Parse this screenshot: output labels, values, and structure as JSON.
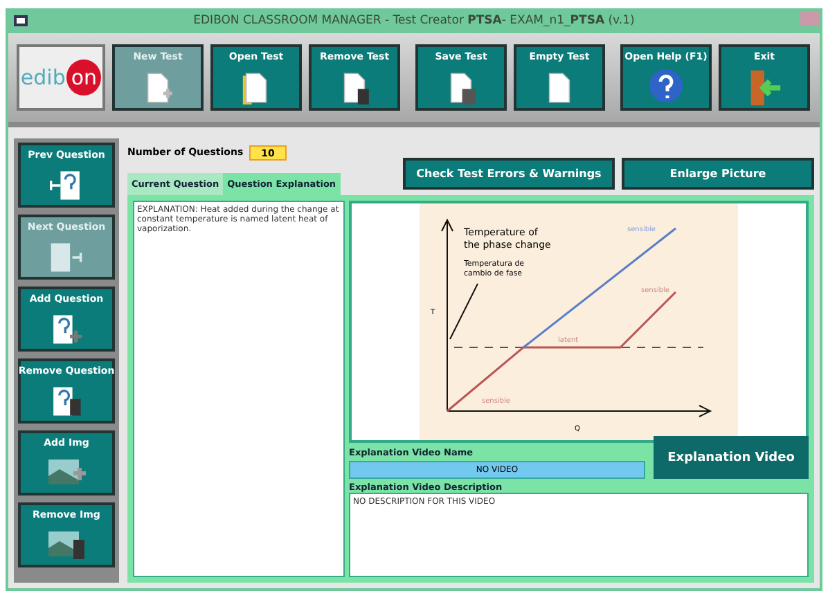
{
  "window": {
    "title": "EDIBON CLASSROOM MANAGER - Test Creator **PTSA**- EXAM_n1_**PTSA** (v.1)"
  },
  "logo": {
    "left": "edib",
    "right": "on"
  },
  "toolbar": [
    {
      "label": "New Test",
      "kind": "new",
      "disabled": true
    },
    {
      "label": "Open Test",
      "kind": "open",
      "disabled": false
    },
    {
      "label": "Remove Test",
      "kind": "remove",
      "disabled": false
    },
    {
      "label": "Save Test",
      "kind": "save",
      "disabled": false
    },
    {
      "label": "Empty Test",
      "kind": "empty",
      "disabled": false
    },
    {
      "label": "Open Help (F1)",
      "kind": "help",
      "disabled": false
    },
    {
      "label": "Exit",
      "kind": "exit",
      "disabled": false
    }
  ],
  "sidebar": [
    {
      "label": "Prev Question",
      "kind": "prev",
      "disabled": false
    },
    {
      "label": "Next Question",
      "kind": "next",
      "disabled": true
    },
    {
      "label": "Add Question",
      "kind": "add",
      "disabled": false
    },
    {
      "label": "Remove Question",
      "kind": "removeq",
      "disabled": false
    },
    {
      "label": "Add Img",
      "kind": "addimg",
      "disabled": false
    },
    {
      "label": "Remove Img",
      "kind": "removeimg",
      "disabled": false
    }
  ],
  "number_of_questions": {
    "label": "Number of Questions",
    "value": "10"
  },
  "tabs": [
    {
      "label": "Current Question",
      "selected": false
    },
    {
      "label": "Question Explanation",
      "selected": true
    }
  ],
  "actions": [
    "Check Test Errors & Warnings",
    "Enlarge Picture"
  ],
  "explanation": {
    "value": "EXPLANATION: Heat added during the change at constant temperature is named latent heat of vaporization."
  },
  "figure": {
    "title_en": "Temperature of the phase change",
    "title_es": "Temperatura de cambio de fase",
    "y_label": "T",
    "x_label": "Q",
    "upper_label": "sensible",
    "right_label": "sensible",
    "middle_label": "latent",
    "lower_label": "sensible"
  },
  "video": {
    "name_label": "Explanation Video Name",
    "name": "NO VIDEO",
    "description_label": "Explanation Video Description",
    "description": "NO DESCRIPTION FOR THIS VIDEO",
    "button": "Explanation Video"
  }
}
